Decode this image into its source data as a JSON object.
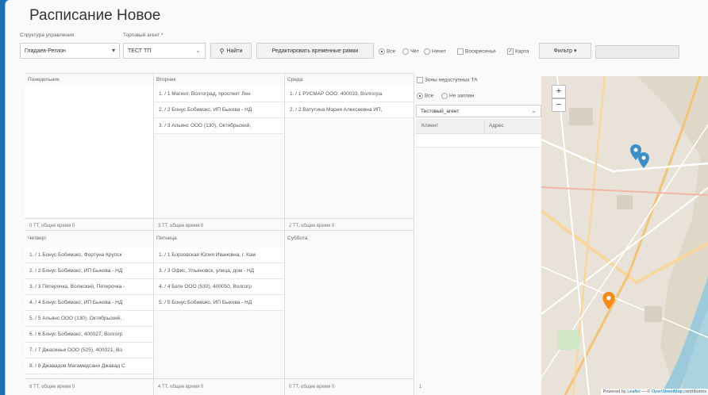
{
  "title": "Расписание Новое",
  "filters": {
    "structure_label": "Структура управления",
    "structure_value": "Гладаев-Регион",
    "agent_label": "Торговый агент *",
    "agent_value": "ТЕСТ ТП",
    "find_button": "Найти",
    "edit_button": "Редактировать временные рамки",
    "radio_all": "Все",
    "radio_even": "Чёт",
    "radio_odd": "Нечет",
    "chk_sunday": "Воскресенье",
    "chk_map": "Карта",
    "filter_button": "Фильтр ▾"
  },
  "days": {
    "mon": {
      "label": "Понедельник",
      "items": [],
      "footer": "0 ТТ, общее время 0"
    },
    "tue": {
      "label": "Вторник",
      "items": [
        "1. / 1 Магнит, Волгоград, проспект Лен",
        "2. / 2 Бонус Бобимэкс, ИП Быкова - НД",
        "3. / 3 Альянс ООО (130), Октябрьский,"
      ],
      "footer": "3 ТТ, общее время 0"
    },
    "wed": {
      "label": "Среда",
      "items": [
        "1. / 1 РУСМАР ООО, 400033, Волгогра",
        "2. / 2 Ватутина Мария Алексеевна ИП,"
      ],
      "footer": "2 ТТ, общее время 0"
    },
    "thu": {
      "label": "Четверг",
      "items": [
        "1. / 1 Бонус Бобимэкс, Фортуна Крупск",
        "2. / 2 Бонус Бобимэкс, ИП Быкова - НД",
        "3. / 3 Пятерочка, Волжский, Пятерочка -",
        "4. / 4 Бонус Бобимэкс, ИП Быкова - НД",
        "5. / 5 Альянс ООО (130), Октябрьский, .",
        "6. / 6 Бонус Бобимэкс, 400027, Волгогр",
        "7. / 7 Джасиньи ООО (525), 400021, Во",
        "8. / 8 Джавадов Магамедсани Джавад С"
      ],
      "footer": "8 ТТ, общее время 0"
    },
    "fri": {
      "label": "Пятница",
      "items": [
        "1. / 1 Борзовская Юлия Ивановна, г. Кам",
        "3. / 3 Офис, Ульяновск, улица, дом - НД",
        "4. / 4 Бети ООО (530), 400050, Волгогр",
        "5. / 5 Бонус Бобимэкс, ИП Быкова - НД"
      ],
      "footer": "4 ТТ, общее время 0"
    },
    "sat": {
      "label": "Суббота",
      "items": [],
      "footer": "0 ТТ, общее время 0"
    }
  },
  "side": {
    "zones_label": "Зоны недоступных ТА",
    "radio_all": "Все",
    "radio_unplanned": "Не заплан",
    "agent_select": "Тестовый_агент",
    "col_client": "Клиент",
    "col_address": "Адрес",
    "footer": "1"
  },
  "map": {
    "zoom_in": "+",
    "zoom_out": "−",
    "attrib_prefix": "Powered by",
    "attrib_leaflet": "Leaflet",
    "attrib_sep": "— ©",
    "attrib_osm": "OpenStreetMap",
    "attrib_suffix": "contributors",
    "marker_blue": "#3d8fc7",
    "marker_orange": "#f28a1c"
  }
}
